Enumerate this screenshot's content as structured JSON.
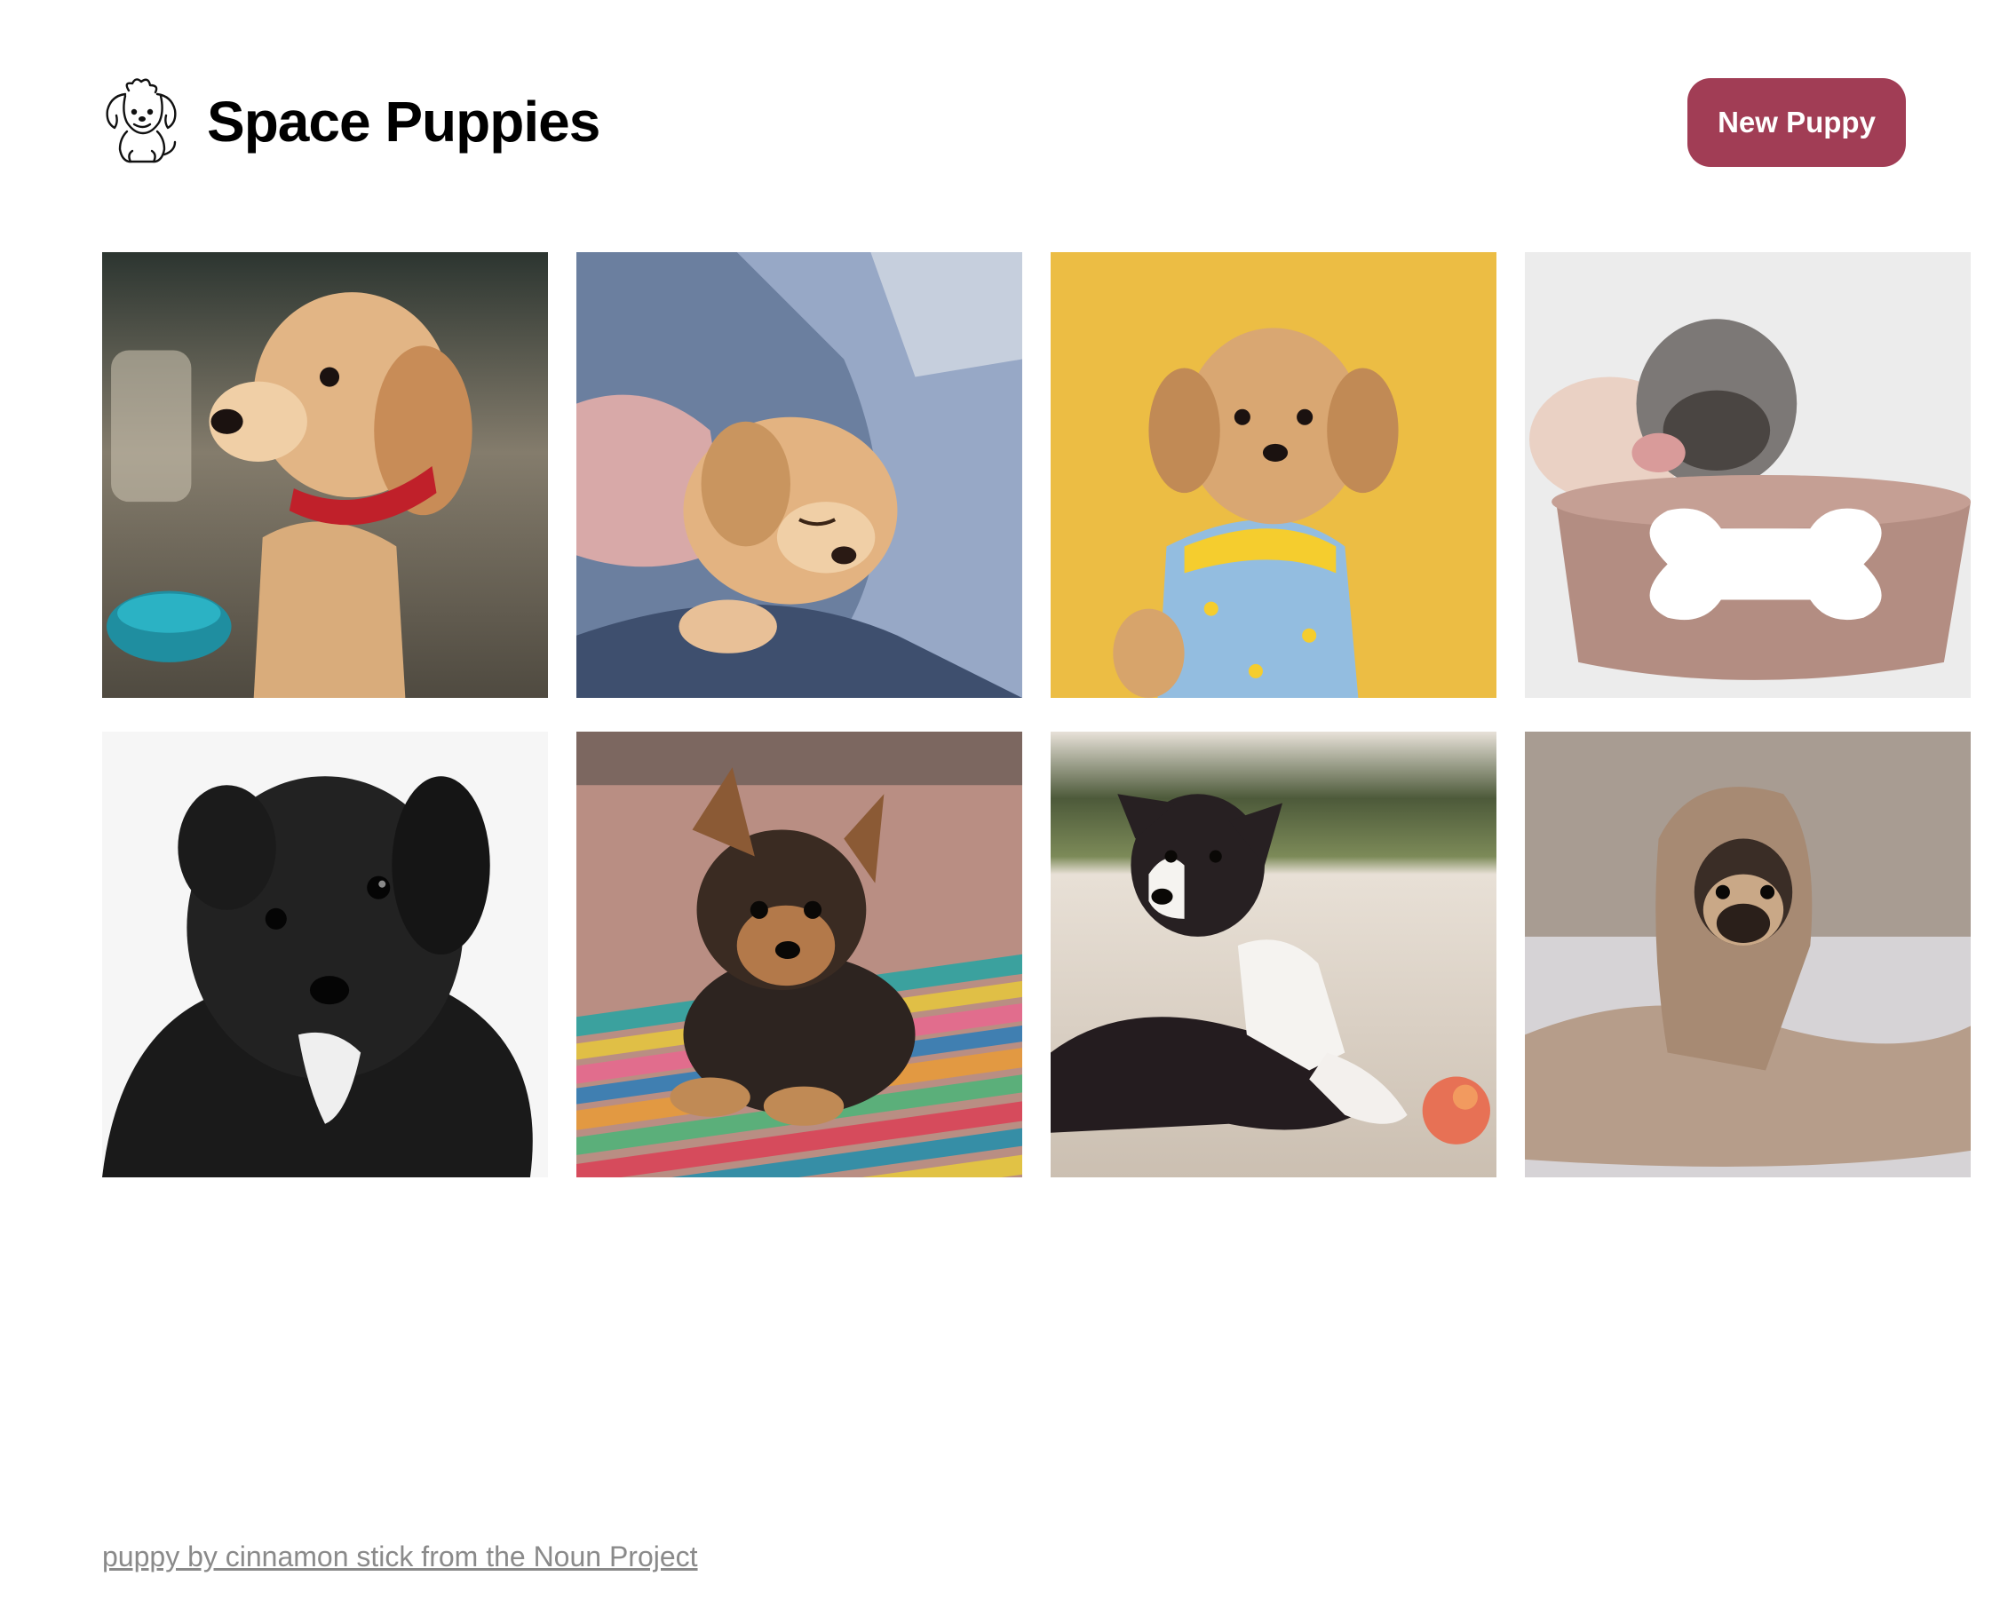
{
  "header": {
    "title": "Space Puppies",
    "logo_icon": "puppy-logo-icon",
    "new_button_label": "New Puppy"
  },
  "colors": {
    "accent": "#a13d55",
    "background": "#ffffff",
    "credit_text": "#8a8a8a"
  },
  "gallery": {
    "columns": 4,
    "items": [
      {
        "subject": "golden retriever puppy with red collar",
        "background": "#6e6a5e"
      },
      {
        "subject": "sleeping golden puppy held in arms",
        "background": "#8fa1bd"
      },
      {
        "subject": "shih tzu puppy in banana pajamas",
        "background": "#e8bd44"
      },
      {
        "subject": "two pug puppies in bowl with bone",
        "background": "#ebebeb"
      },
      {
        "subject": "black fluffy puppy",
        "background": "#f7f7f7"
      },
      {
        "subject": "yorkshire terrier puppy on striped rug",
        "background": "#b7a08f"
      },
      {
        "subject": "black and white puppy on sand with ball",
        "background": "#d8cbbd"
      },
      {
        "subject": "pug wrapped in blanket",
        "background": "#b0a498"
      }
    ]
  },
  "footer": {
    "credit_link": "puppy by cinnamon stick from the Noun Project"
  }
}
